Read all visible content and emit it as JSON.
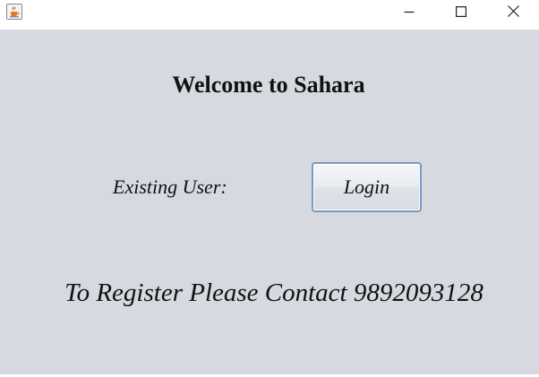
{
  "titlebar": {
    "icon": "java-coffee-cup-icon",
    "controls": {
      "minimize": "minimize-icon",
      "maximize": "maximize-icon",
      "close": "close-icon"
    }
  },
  "main": {
    "welcome_text": "Welcome to Sahara",
    "existing_user_label": "Existing User:",
    "login_button_label": "Login",
    "register_text": "To Register Please Contact 9892093128"
  },
  "colors": {
    "panel_background": "#d6d9e0",
    "button_border": "#7a9ac0",
    "text": "#111111"
  }
}
